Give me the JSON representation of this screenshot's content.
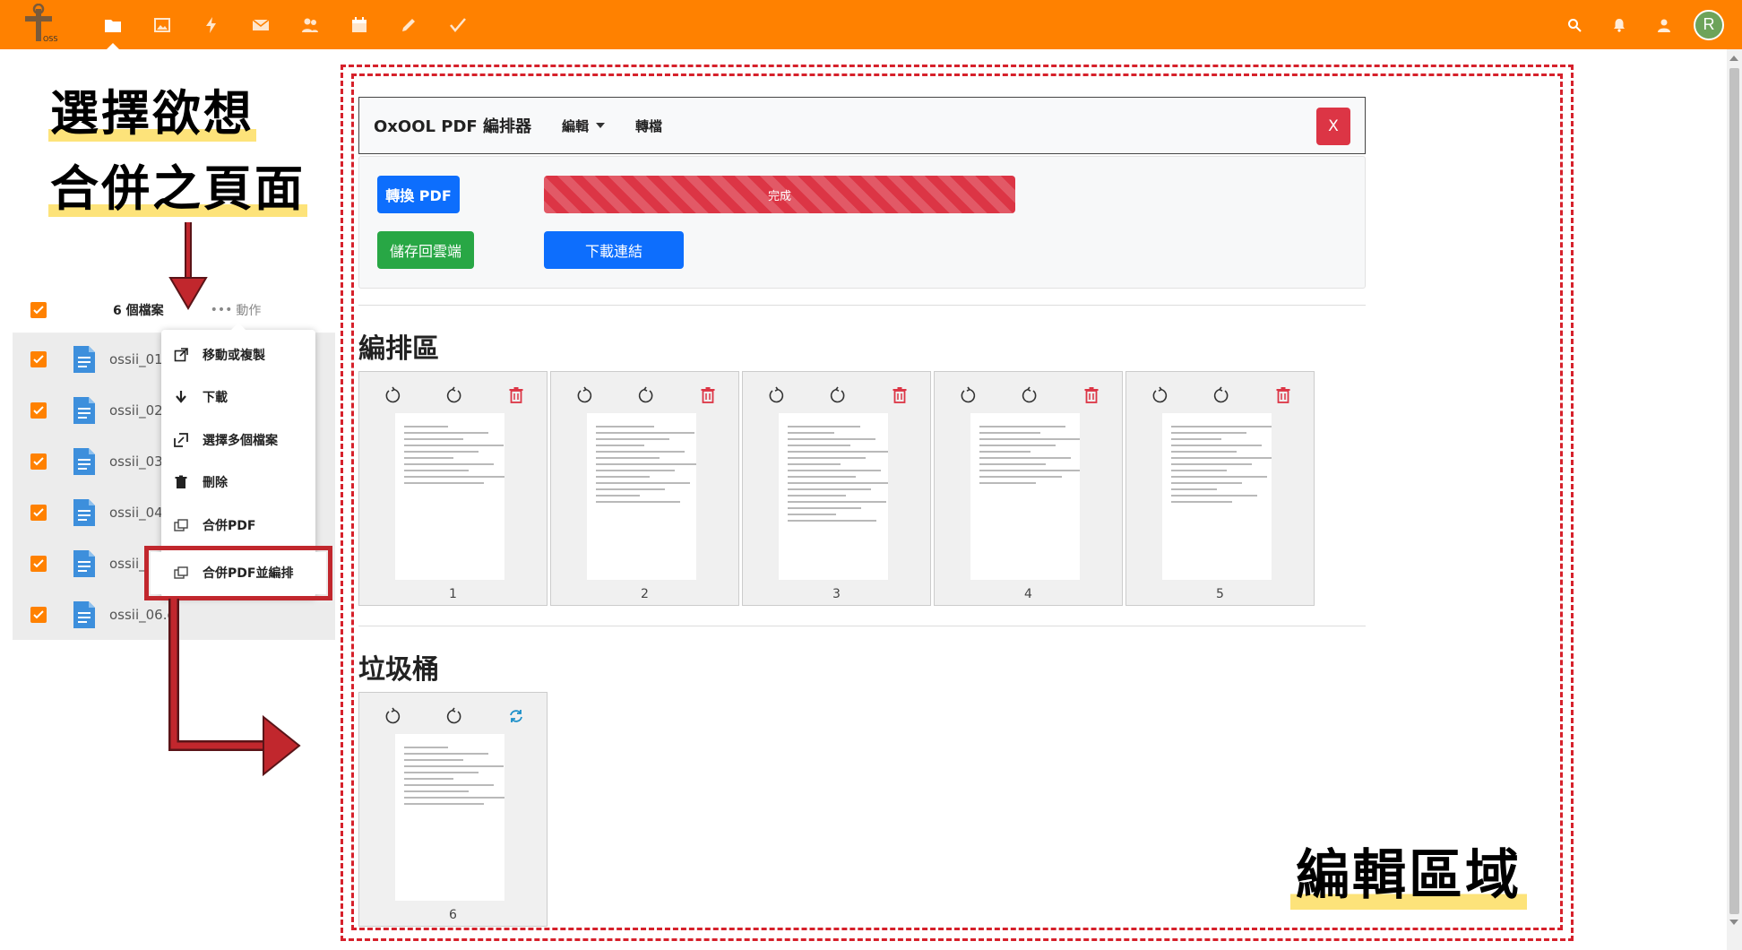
{
  "topbar": {
    "logo_text": "OSS",
    "apps": [
      "files-icon",
      "photos-icon",
      "activity-icon",
      "mail-icon",
      "contacts-icon",
      "calendar-icon",
      "notes-icon",
      "tasks-icon"
    ],
    "avatar_letter": "R",
    "colors": {
      "bar": "#ff8100",
      "avatar": "#6da35a"
    }
  },
  "annotation": {
    "line1": "選擇欲想",
    "line2": "合併之頁面",
    "edit_area": "編輯區域"
  },
  "files": {
    "count_label": "6 個檔案",
    "actions_label": "動作",
    "items": [
      "ossii_01.",
      "ossii_02.",
      "ossii_03.",
      "ossii_04.",
      "ossii_",
      "ossii_06.oc"
    ]
  },
  "menu": {
    "items": [
      "移動或複製",
      "下載",
      "選擇多個檔案",
      "刪除",
      "合併PDF",
      "合併PDF並編排"
    ]
  },
  "editor": {
    "brand": "OxOOL PDF 編排器",
    "nav_edit": "編輯",
    "nav_convert": "轉檔",
    "close": "X",
    "convert_button": "轉換 PDF",
    "progress_label": "完成",
    "progress_value": 1.0,
    "save_button": "儲存回雲端",
    "download_button": "下載連結",
    "arrange_title": "編排區",
    "trash_title": "垃圾桶",
    "arrange_pages": [
      "1",
      "2",
      "3",
      "4",
      "5"
    ],
    "trash_pages": [
      "6"
    ],
    "colors": {
      "danger": "#dc3545",
      "primary": "#0d6efd",
      "success": "#28a745",
      "restore": "#1a8fc9"
    }
  }
}
